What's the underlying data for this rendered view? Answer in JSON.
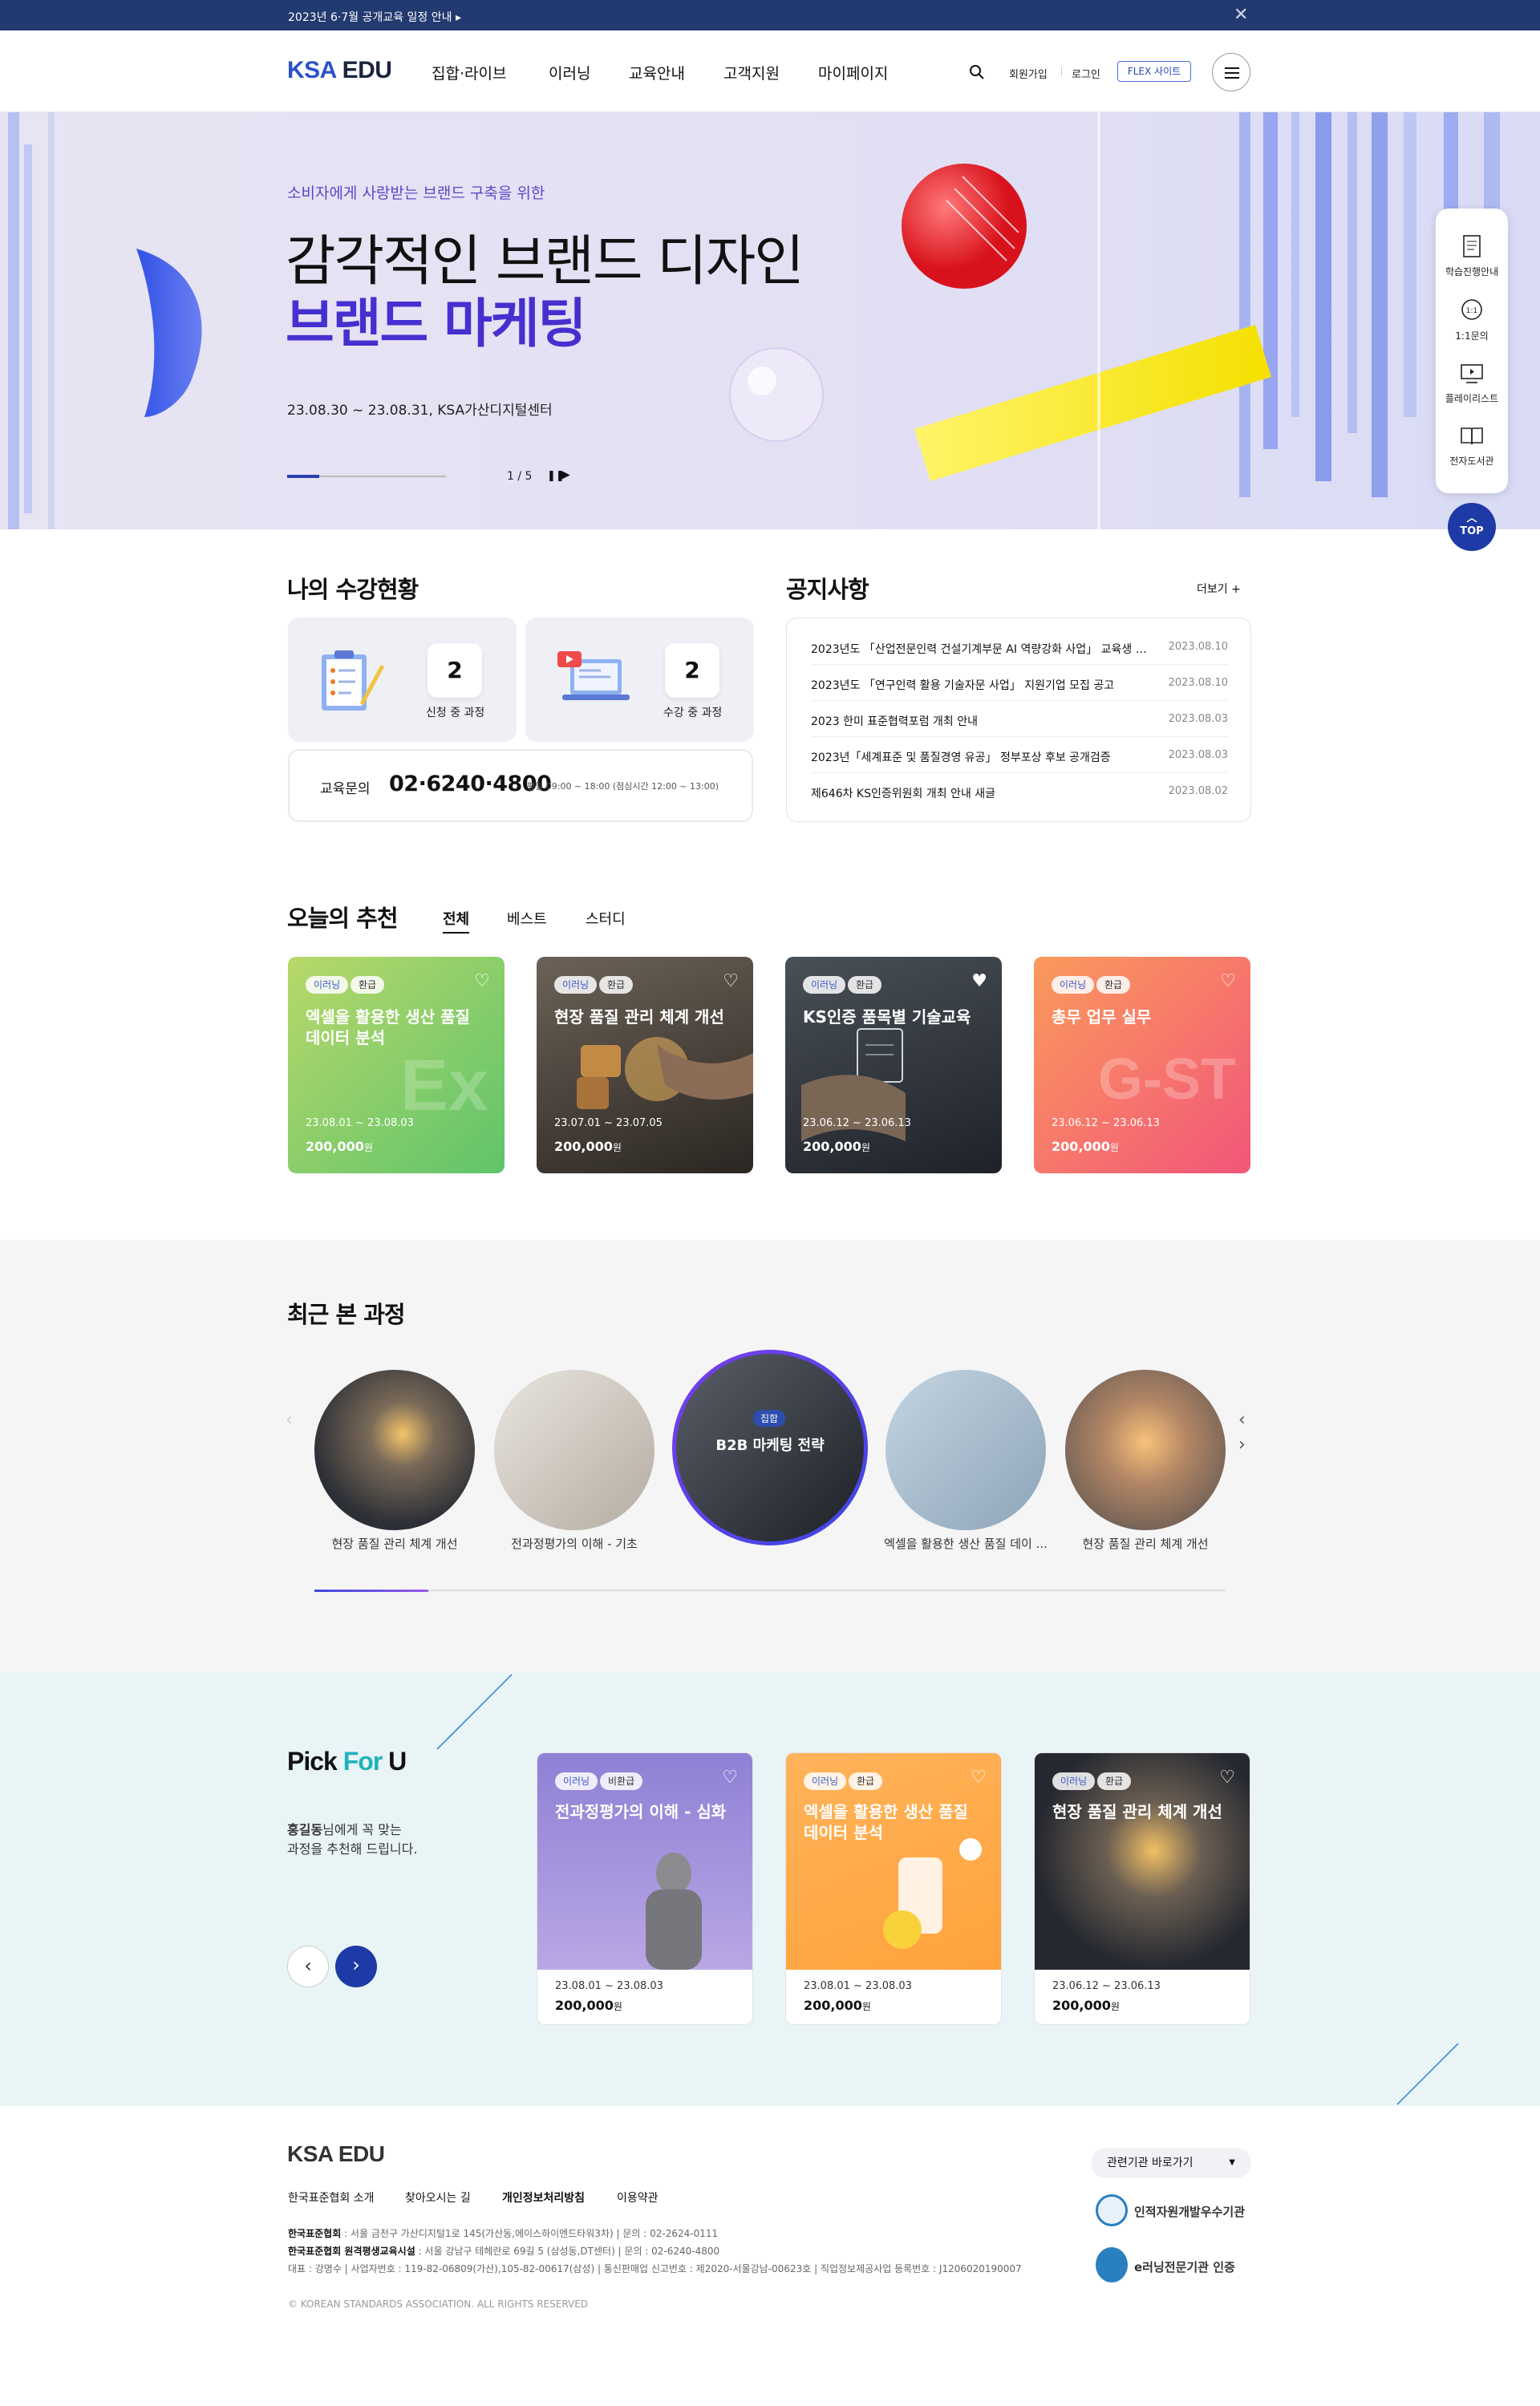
{
  "topbar": {
    "message": "2023년 6·7월 공개교육 일정 안내 ▸"
  },
  "header": {
    "logo_prefix": "KSA",
    "logo_suffix": " EDU",
    "nav": [
      "집합·라이브",
      "이러닝",
      "교육안내",
      "고객지원",
      "마이페이지"
    ],
    "join": "회원가입",
    "login": "로그인",
    "flex": "FLEX 사이트"
  },
  "hero": {
    "subtitle": "소비자에게 사랑받는 브랜드 구축을 위한",
    "title1": "감각적인 브랜드 디자인",
    "title2": "브랜드 마케팅",
    "date": "23.08.30 ~ 23.08.31, KSA가산디지털센터",
    "page": "1 / 5",
    "progress": 0.2
  },
  "quick": {
    "items": [
      "학습진행안내",
      "1:1문의",
      "플레이리스트",
      "전자도서관"
    ],
    "top": "TOP"
  },
  "my": {
    "title": "나의 수강현황",
    "apply_count": "2",
    "apply_label": "신청 중 과정",
    "study_count": "2",
    "study_label": "수강 중 과정",
    "inquiry_label": "교육문의",
    "phone": "02·6240·4800",
    "hours": "평일 09:00 ~ 18:00 (점심시간 12:00 ~ 13:00)"
  },
  "notice": {
    "title": "공지사항",
    "more": "더보기 +",
    "items": [
      {
        "title": "2023년도 「산업전문인력 건설기계부문 AI 역량강화 사업」 교육생 모집 ...",
        "date": "2023.08.10"
      },
      {
        "title": "2023년도 「연구인력 활용 기술자문 사업」 지원기업 모집 공고",
        "date": "2023.08.10"
      },
      {
        "title": "2023 한미 표준협력포럼 개최 안내",
        "date": "2023.08.03"
      },
      {
        "title": "2023년「세계표준 및 품질경영 유공」 정부포상 후보 공개검증",
        "date": "2023.08.03"
      },
      {
        "title": "제646차 KS인증위원회 개최 안내 새글",
        "date": "2023.08.02"
      }
    ]
  },
  "recommend": {
    "title": "오늘의 추천",
    "tabs": [
      "전체",
      "베스트",
      "스터디"
    ],
    "cards": [
      {
        "badge1": "이러닝",
        "badge2": "환급",
        "title": "엑셀을 활용한 생산 품질 데이터 분석",
        "date": "23.08.01 ~ 23.08.03",
        "price": "200,000",
        "unit": "원",
        "bgtext": "Ex"
      },
      {
        "badge1": "이러닝",
        "badge2": "환급",
        "title": "현장 품질 관리 체계 개선",
        "date": "23.07.01 ~ 23.07.05",
        "price": "200,000",
        "unit": "원",
        "bgtext": ""
      },
      {
        "badge1": "이러닝",
        "badge2": "환급",
        "title": "KS인증 품목별 기술교육",
        "date": "23.06.12 ~ 23.06.13",
        "price": "200,000",
        "unit": "원",
        "bgtext": ""
      },
      {
        "badge1": "이러닝",
        "badge2": "환급",
        "title": "총무 업무 실무",
        "date": "23.06.12 ~ 23.06.13",
        "price": "200,000",
        "unit": "원",
        "bgtext": "G-ST"
      }
    ]
  },
  "recent": {
    "title": "최근 본 과정",
    "items": [
      "현장 품질 관리 체계 개선",
      "전과정평가의 이해 - 기초",
      "B2B 마케팅 전략",
      "엑셀을 활용한 생산 품질 데이 ...",
      "현장 품질 관리 체계 개선"
    ],
    "center_badge": "집합"
  },
  "pick": {
    "title_a": "Pick ",
    "title_b": "For",
    "title_c": " U",
    "user": "홍길동",
    "desc1": "님에게 꼭 맞는",
    "desc2": "과정을 추천해 드립니다.",
    "cards": [
      {
        "badge1": "이러닝",
        "badge2": "비환급",
        "title": "전과정평가의 이해 - 심화",
        "date": "23.08.01 ~ 23.08.03",
        "price": "200,000",
        "unit": "원"
      },
      {
        "badge1": "이러닝",
        "badge2": "환급",
        "title": "엑셀을 활용한 생산 품질 데이터 분석",
        "date": "23.08.01 ~ 23.08.03",
        "price": "200,000",
        "unit": "원"
      },
      {
        "badge1": "이러닝",
        "badge2": "환급",
        "title": "현장 품질 관리 체계 개선",
        "date": "23.06.12 ~ 23.06.13",
        "price": "200,000",
        "unit": "원"
      }
    ]
  },
  "footer": {
    "links": [
      "한국표준협회 소개",
      "찾아오시는 길",
      "개인정보처리방침",
      "이용약관"
    ],
    "line1_name": "한국표준협회",
    "line1": " : 서울 금천구 가산디지털1로 145(가산동,에이스하이엔드타워3차)  |  문의 : 02-2624-0111",
    "line2_name": "한국표준협회 원격평생교육시설",
    "line2": " : 서울 강남구 테헤란로 69길 5 (삼성동,DT센터)  |  문의 : 02-6240-4800",
    "line3": "대표 : 강명수  |  사업자번호 : 119-82-06809(가산),105-82-00617(삼성)  |  통신판매업 신고번호 : 제2020-서울강남-00623호  |  직업정보제공사업 등록번호 : J1206020190007",
    "copyright": "© KOREAN STANDARDS ASSOCIATION. ALL RIGHTS RESERVED",
    "related": "관련기관 바로가기",
    "cert1": "인적자원개발우수기관",
    "cert2": "e러닝전문기관 인증"
  }
}
